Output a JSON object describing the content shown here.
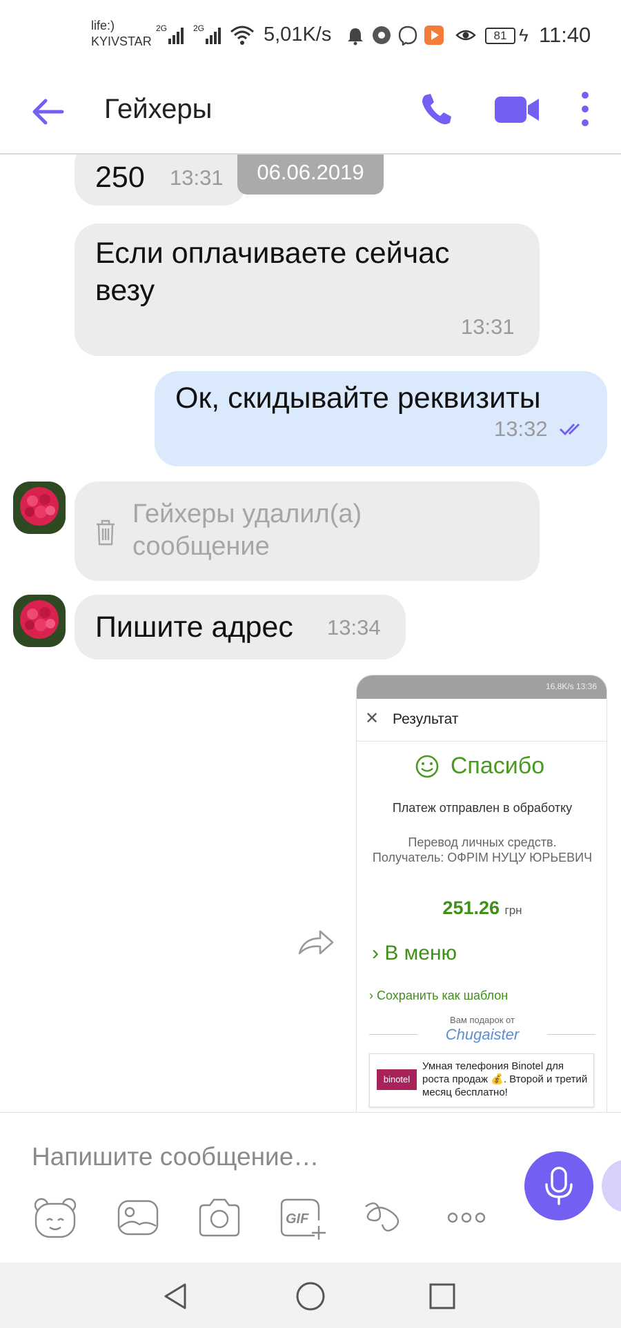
{
  "status_bar": {
    "carrier_1": "life:)",
    "carrier_2": "KYIVSTAR",
    "network_1": "2G",
    "network_2": "2G",
    "speed": "5,01K/s",
    "battery": "81",
    "time": "11:40"
  },
  "header": {
    "title": "Гейхеры"
  },
  "chat": {
    "date_badge": "06.06.2019",
    "messages": [
      {
        "text": "250",
        "time": "13:31"
      },
      {
        "text_line1": "Если оплачиваете сейчас",
        "text_line2": "везу",
        "time": "13:31"
      },
      {
        "text": "Ок,  скидывайте реквизиты",
        "time": "13:32"
      },
      {
        "deleted_line1": "Гейхеры удалил(а)",
        "deleted_line2": "сообщение"
      },
      {
        "text": "Пишите адрес",
        "time": "13:34"
      }
    ],
    "screenshot": {
      "status_text": "16,8K/s  13:36",
      "title": "Результат",
      "thanks": "Спасибо",
      "sent": "Платеж отправлен в обработку",
      "transfer": "Перевод личных средств.",
      "recipient": "Получатель: ОФРІМ НУЦУ ЮРЬЕВИЧ",
      "amount": "251.26",
      "currency": "грн",
      "menu": "В меню",
      "save_template": "Сохранить как шаблон",
      "gift": "Вам подарок от",
      "brand": "Chugaister",
      "ad_logo": "binotel",
      "ad_text": "Умная телефония Binotel для роста продаж 💰. Второй и третий месяц бесплатно!"
    }
  },
  "composer": {
    "placeholder": "Напишите сообщение…",
    "tools": [
      "sticker-icon",
      "gallery-icon",
      "camera-icon",
      "gif-icon",
      "doodle-icon",
      "more-icon"
    ],
    "accent": "#7360f2"
  },
  "colors": {
    "incoming_bubble": "#ececec",
    "outgoing_bubble": "#dbe9fd",
    "accent": "#7360f2"
  }
}
